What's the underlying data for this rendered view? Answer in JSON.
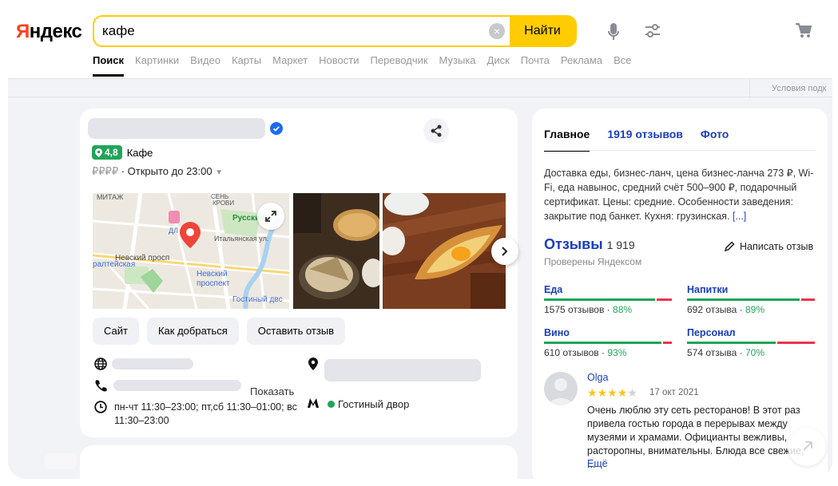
{
  "header": {
    "logo": {
      "first": "Я",
      "rest": "ндекс"
    },
    "search_value": "кафе",
    "find_label": "Найти",
    "nav": [
      "Поиск",
      "Картинки",
      "Видео",
      "Карты",
      "Маркет",
      "Новости",
      "Переводчик",
      "Музыка",
      "Диск",
      "Почта",
      "Реклама",
      "Все"
    ],
    "terms": "Условия подк"
  },
  "business": {
    "rating": "4,8",
    "category": "Кафе",
    "price": "₽₽₽₽",
    "status": "· Открыто до 23:00",
    "map_labels": {
      "mitazh": "МИТАЖ",
      "seny": "СЕНЬ",
      "krovi": "КРОВИ",
      "russkiy": "Русский",
      "dl": "ДЛ",
      "italyanskaya": "Итальянская ул.",
      "nevskiy_prosp": "Невский просп",
      "admiralteyskaya": "ралтейская",
      "nevskiy_prospekt": "Невский\nпроспект",
      "gostiny": "Гостиный двс"
    },
    "buttons": [
      "Сайт",
      "Как добраться",
      "Оставить отзыв"
    ],
    "phone_show": "Показать",
    "hours": "пн-чт 11:30–23:00; пт,сб 11:30–01:00; вс 11:30–23:00",
    "metro": "Гостиный двор"
  },
  "panel": {
    "tabs": [
      "Главное",
      "1919 отзывов",
      "Фото"
    ],
    "description": "Доставка еды, бизнес-ланч, цена бизнес-ланча 273 ₽, Wi-Fi, еда навынос, средний счёт 500–900 ₽, подарочный сертификат. Цены: средние. Особенности заведения: закрытие под банкет. Кухня: грузинская.",
    "description_more": "[...]",
    "reviews_title": "Отзывы",
    "reviews_count": "1 919",
    "checked": "Проверены Яндексом",
    "write_review": "Написать отзыв",
    "categories": [
      {
        "name": "Еда",
        "stat": "1575 отзывов · ",
        "pct": "88%",
        "value": 0.88
      },
      {
        "name": "Напитки",
        "stat": "692 отзыва · ",
        "pct": "89%",
        "value": 0.89
      },
      {
        "name": "Вино",
        "stat": "610 отзывов · ",
        "pct": "93%",
        "value": 0.93
      },
      {
        "name": "Персонал",
        "stat": "574 отзыва · ",
        "pct": "70%",
        "value": 0.7
      }
    ],
    "review": {
      "author": "Olga",
      "stars": 4,
      "date": "17 окт 2021",
      "text": "Очень люблю эту сеть ресторанов! В этот раз привела гостью города в перерывах между музеями и храмами. Официанты вежливы, расторопны, внимательны. Блюда все свежие, ...",
      "more": "Ещё"
    }
  },
  "colors": {
    "accent_yellow": "#ffcc00",
    "link_blue": "#1a3eb8",
    "rating_green": "#1fa55a",
    "negative_red": "#f0334d",
    "logo_red": "#fc3f1d"
  }
}
